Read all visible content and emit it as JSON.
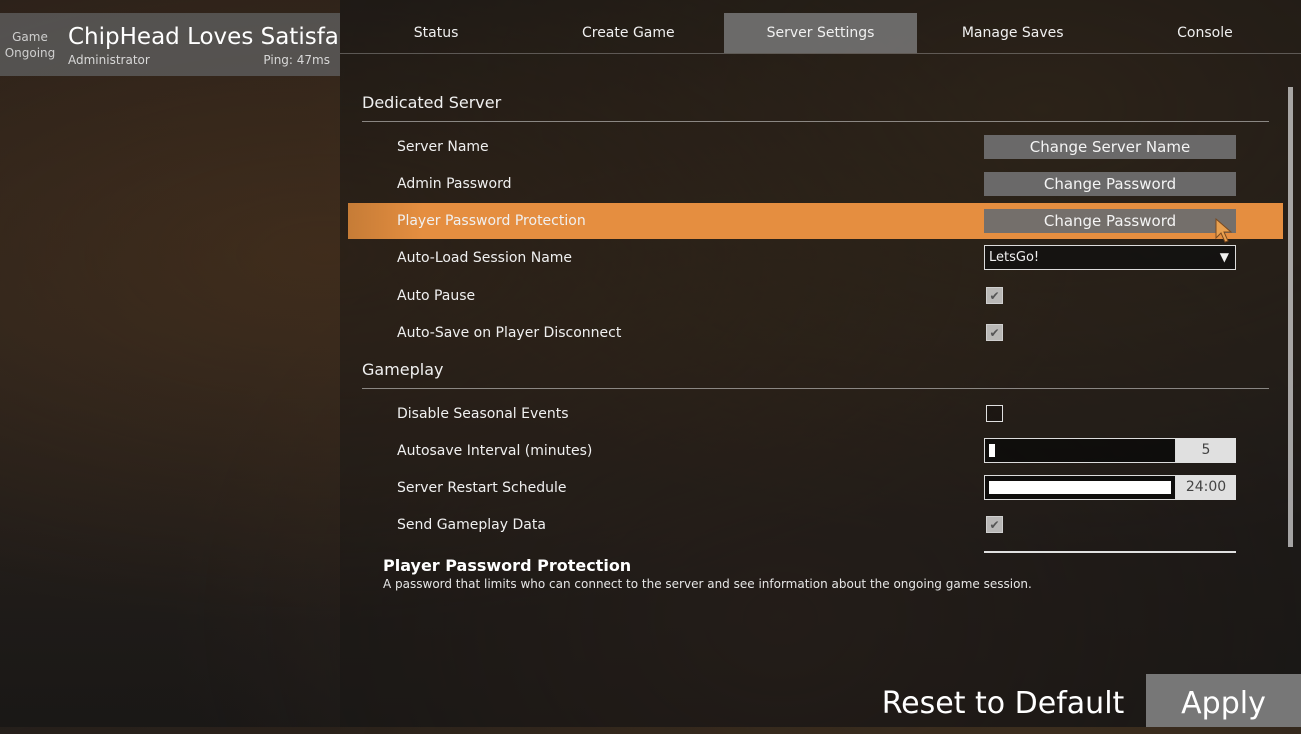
{
  "session": {
    "state_line1": "Game",
    "state_line2": "Ongoing",
    "name": "ChipHead Loves Satisfactory",
    "role": "Administrator",
    "ping": "Ping: 47ms"
  },
  "tabs": [
    {
      "label": "Status"
    },
    {
      "label": "Create Game"
    },
    {
      "label": "Server Settings",
      "active": true
    },
    {
      "label": "Manage Saves"
    },
    {
      "label": "Console"
    }
  ],
  "sections": {
    "dedicated": {
      "title": "Dedicated Server",
      "server_name": {
        "label": "Server Name",
        "button": "Change Server Name"
      },
      "admin_password": {
        "label": "Admin Password",
        "button": "Change Password"
      },
      "player_password": {
        "label": "Player Password Protection",
        "button": "Change Password"
      },
      "autoload": {
        "label": "Auto-Load Session Name",
        "value": "LetsGo!"
      },
      "auto_pause": {
        "label": "Auto Pause",
        "checked": true
      },
      "autosave_disconnect": {
        "label": "Auto-Save on Player Disconnect",
        "checked": true
      }
    },
    "gameplay": {
      "title": "Gameplay",
      "seasonal": {
        "label": "Disable Seasonal Events",
        "checked": false
      },
      "autosave_interval": {
        "label": "Autosave Interval (minutes)",
        "value": "5",
        "fill_fraction": 0.03
      },
      "restart_schedule": {
        "label": "Server Restart Schedule",
        "value": "24:00",
        "fill_fraction": 1.0
      },
      "gameplay_data": {
        "label": "Send Gameplay Data",
        "checked": true
      }
    }
  },
  "description": {
    "title": "Player Password Protection",
    "text": "A password that limits who can connect to the server and see information about the ongoing game session."
  },
  "footer": {
    "reset_label": "Reset to Default",
    "apply_label": "Apply"
  },
  "icons": {
    "check": "check-icon",
    "dropdown": "triangle-down-icon",
    "cursor": "mouse-pointer-icon"
  },
  "colors": {
    "highlight": "#e58e40",
    "button": "#6e6e6e"
  }
}
